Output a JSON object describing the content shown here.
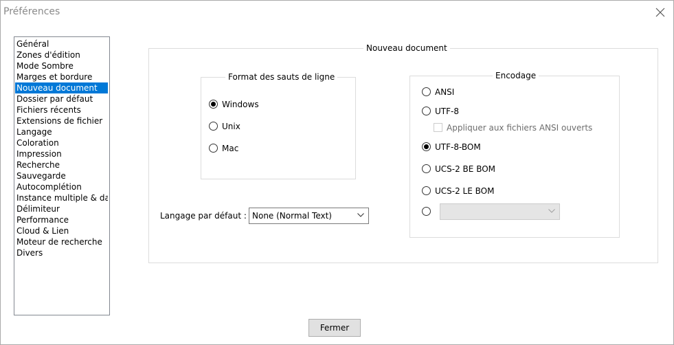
{
  "window": {
    "title": "Préférences"
  },
  "sidebar": {
    "items": [
      {
        "label": "Général"
      },
      {
        "label": "Zones d'édition"
      },
      {
        "label": "Mode Sombre"
      },
      {
        "label": "Marges et bordure"
      },
      {
        "label": "Nouveau document",
        "selected": true
      },
      {
        "label": "Dossier par défaut"
      },
      {
        "label": "Fichiers récents"
      },
      {
        "label": "Extensions de fichier"
      },
      {
        "label": "Langage"
      },
      {
        "label": "Coloration"
      },
      {
        "label": "Impression"
      },
      {
        "label": "Recherche"
      },
      {
        "label": "Sauvegarde"
      },
      {
        "label": "Autocomplétion"
      },
      {
        "label": "Instance multiple & date"
      },
      {
        "label": "Délimiteur"
      },
      {
        "label": "Performance"
      },
      {
        "label": "Cloud & Lien"
      },
      {
        "label": "Moteur de recherche"
      },
      {
        "label": "Divers"
      }
    ]
  },
  "panel": {
    "title": "Nouveau document"
  },
  "line_endings": {
    "title": "Format des sauts de ligne",
    "options": [
      {
        "label": "Windows",
        "checked": true
      },
      {
        "label": "Unix",
        "checked": false
      },
      {
        "label": "Mac",
        "checked": false
      }
    ]
  },
  "default_language": {
    "label": "Langage par défaut :",
    "value": "None (Normal Text)"
  },
  "encoding": {
    "title": "Encodage",
    "options": [
      {
        "label": "ANSI",
        "checked": false
      },
      {
        "label": "UTF-8",
        "checked": false
      },
      {
        "label": "UTF-8-BOM",
        "checked": true
      },
      {
        "label": "UCS-2 BE BOM",
        "checked": false
      },
      {
        "label": "UCS-2 LE BOM",
        "checked": false
      }
    ],
    "apply_ansi_label": "Appliquer aux fichiers ANSI ouverts",
    "apply_ansi_checked": false,
    "other_charset_value": ""
  },
  "buttons": {
    "close_label": "Fermer"
  },
  "colors": {
    "selection": "#0078d7",
    "title_text": "#8a8a8a"
  }
}
